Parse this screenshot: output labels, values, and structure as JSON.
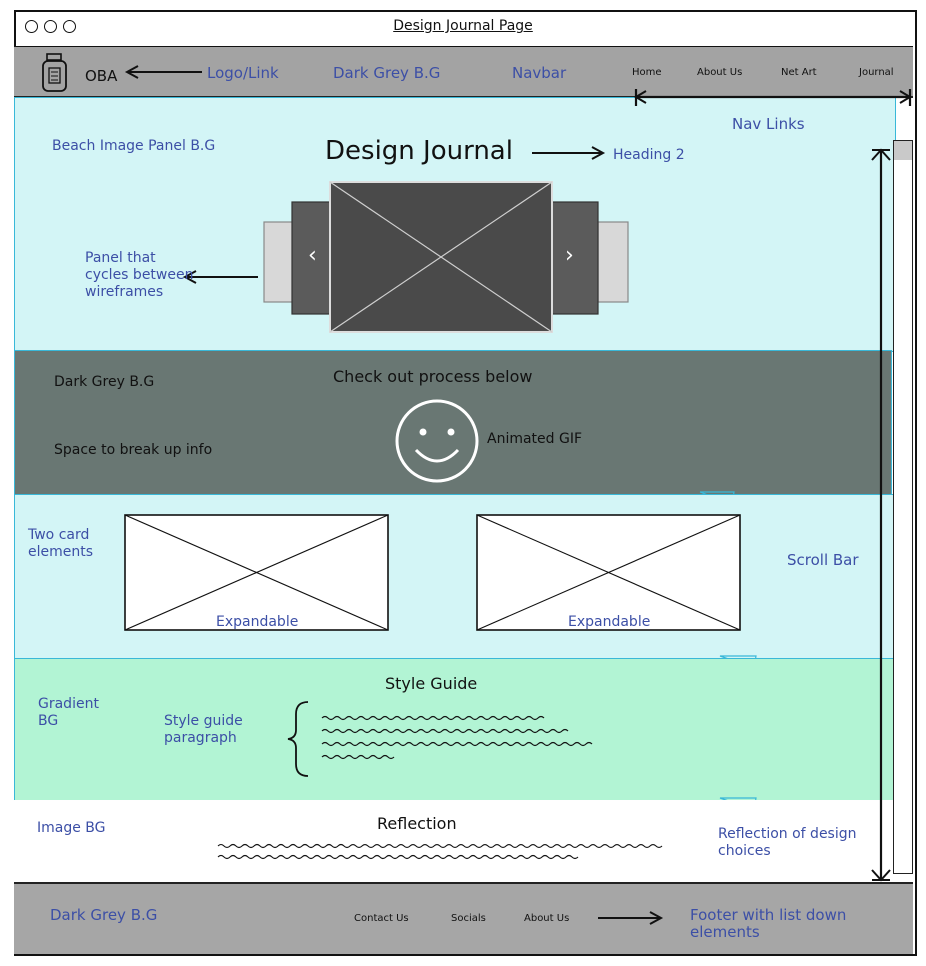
{
  "window": {
    "title": "Design Journal Page"
  },
  "navbar": {
    "logo_text": "OBA",
    "logo_annotation": "Logo/Link",
    "bg_annotation": "Dark Grey B.G",
    "navbar_annotation": "Navbar",
    "links": [
      "Home",
      "About Us",
      "Net Art",
      "Journal"
    ],
    "links_annotation": "Nav Links"
  },
  "hero": {
    "bg_annotation": "Beach Image Panel B.G",
    "heading": "Design Journal",
    "heading_annotation": "Heading 2",
    "carousel_annotation": "Panel that cycles between wireframes",
    "prev_glyph": "‹",
    "next_glyph": "›"
  },
  "break_section": {
    "bg_annotation": "Dark Grey B.G",
    "space_annotation": "Space to break up info",
    "text": "Check out process below",
    "gif_annotation": "Animated GIF"
  },
  "cards_section": {
    "annotation": "Two card elements",
    "cards": [
      {
        "label": "Expandable"
      },
      {
        "label": "Expandable"
      }
    ],
    "scrollbar_annotation": "Scroll Bar"
  },
  "style_guide": {
    "bg_annotation": "Gradient BG",
    "heading": "Style Guide",
    "paragraph_annotation": "Style guide paragraph"
  },
  "reflection": {
    "bg_annotation": "Image BG",
    "heading": "Reflection",
    "annotation": "Reflection of design choices"
  },
  "footer": {
    "bg_annotation": "Dark Grey B.G",
    "links": [
      "Contact Us",
      "Socials",
      "About Us"
    ],
    "annotation": "Footer with list down elements"
  },
  "colors": {
    "annotation_blue": "#3c4fa6",
    "beach_bg": "#d3f5f6",
    "dark_grey_band": "#697773",
    "gradient_bg": "#b2f4d4",
    "navbar_grey": "#a3a3a3",
    "section_border": "#39b8d8"
  }
}
